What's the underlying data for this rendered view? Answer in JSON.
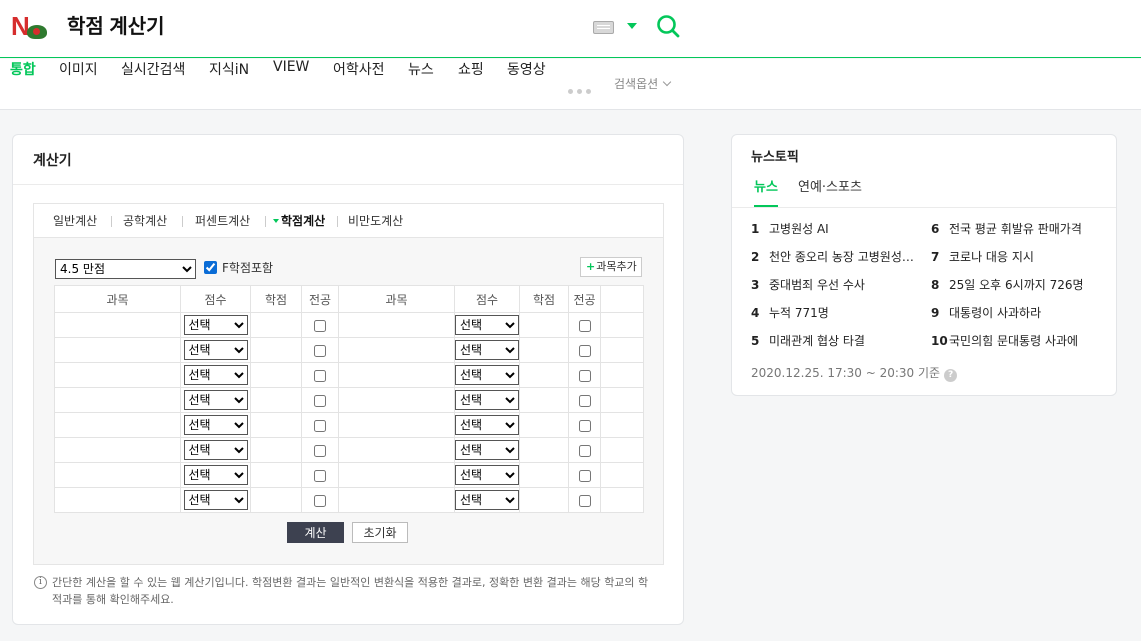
{
  "header": {
    "logo_letter": "N",
    "query": "학점 계산기"
  },
  "nav": {
    "items": [
      "통합",
      "이미지",
      "실시간검색",
      "지식iN",
      "VIEW",
      "어학사전",
      "뉴스",
      "쇼핑",
      "동영상"
    ],
    "options_label": "검색옵션"
  },
  "calculator": {
    "title": "계산기",
    "tabs": [
      "일반계산",
      "공학계산",
      "퍼센트계산",
      "학점계산",
      "비만도계산"
    ],
    "scale_selected": "4.5 만점",
    "include_f_label": "F학점포함",
    "add_subject_label": "과목추가",
    "headers": [
      "과목",
      "점수",
      "학점",
      "전공",
      "과목",
      "점수",
      "학점",
      "전공"
    ],
    "score_placeholder": "선택",
    "calc_label": "계산",
    "reset_label": "초기화",
    "info_text": "간단한 계산을 할 수 있는 웹 계산기입니다. 학점변환 결과는 일반적인 변환식을 적용한 결과로, 정확한 변환 결과는 해당 학교의 학적과를 통해 확인해주세요."
  },
  "news": {
    "title": "뉴스토픽",
    "tabs": [
      "뉴스",
      "연예·스포츠"
    ],
    "items": [
      {
        "rank": "1",
        "text": "고병원성 AI"
      },
      {
        "rank": "2",
        "text": "천안 종오리 농장 고병원성 AI 확진"
      },
      {
        "rank": "3",
        "text": "중대범죄 우선 수사"
      },
      {
        "rank": "4",
        "text": "누적 771명"
      },
      {
        "rank": "5",
        "text": "미래관계 협상 타결"
      },
      {
        "rank": "6",
        "text": "전국 평균 휘발유 판매가격"
      },
      {
        "rank": "7",
        "text": "코로나 대응 지시"
      },
      {
        "rank": "8",
        "text": "25일 오후 6시까지 726명"
      },
      {
        "rank": "9",
        "text": "대통령이 사과하라"
      },
      {
        "rank": "10",
        "text": "국민의힘 문대통령 사과에"
      }
    ],
    "timestamp": "2020.12.25. 17:30 ~ 20:30 기준"
  },
  "colors": {
    "accent": "#03c75a",
    "logo_red": "#d62d2d",
    "calc_button": "#3d4150"
  }
}
